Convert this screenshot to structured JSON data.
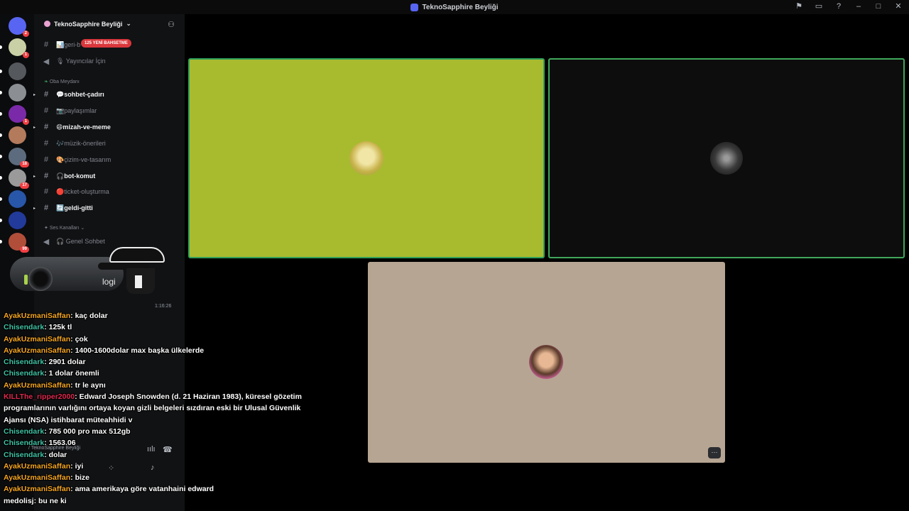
{
  "window": {
    "title": "TeknoSapphire Beyliği"
  },
  "servers": [
    {
      "badge": "2",
      "color": "#5865f2"
    },
    {
      "badge": "1",
      "color": "#c9d0a5"
    },
    {
      "badge": "",
      "color": "#55585d"
    },
    {
      "badge": "",
      "color": "#8b8e93"
    },
    {
      "badge": "1",
      "color": "#7a2aa8"
    },
    {
      "badge": "",
      "color": "#b37a5c"
    },
    {
      "badge": "18",
      "color": "#5c6c7e"
    },
    {
      "badge": "17",
      "color": "#9a9a9a"
    },
    {
      "badge": "",
      "color": "#2856a8"
    },
    {
      "badge": "",
      "color": "#223a9a"
    },
    {
      "badge": "99",
      "color": "#b04e3a"
    }
  ],
  "sidebar": {
    "guild_name": "TeknoSapphire Beyliği",
    "mention_pill": "125 YENİ BAHSETME",
    "channels_top": [
      {
        "icon": "#",
        "label": "📊geri-b",
        "active": false
      },
      {
        "icon": "🔊",
        "label": "🎙 Yayıncılar İçin",
        "active": false
      }
    ],
    "category_1": "Oba Meydanı",
    "channels_1": [
      {
        "icon": "#",
        "label": "💬sohbet-çadırı",
        "active": true
      },
      {
        "icon": "#",
        "label": "📷paylaşımlar",
        "active": false
      },
      {
        "icon": "#",
        "label": "😄mizah-ve-meme",
        "active": true
      },
      {
        "icon": "#",
        "label": "🎶müzik-önerileri",
        "active": false
      },
      {
        "icon": "#",
        "label": "🎨çizim-ve-tasarım",
        "active": false
      },
      {
        "icon": "#",
        "label": "🎧bot-komut",
        "active": true
      },
      {
        "icon": "#",
        "label": "🔴ticket-oluşturma",
        "active": false
      },
      {
        "icon": "#",
        "label": "🔄geldi-gitti",
        "active": true
      }
    ],
    "category_2": "Ses Kanalları",
    "voice_channel": "🎧 Genel Sohbet",
    "voice_connected": "/ TeknoSapphire Beyliği"
  },
  "stage": {
    "tiles": [
      {
        "bg": "#a8bb2f",
        "border": "#2fa05a"
      },
      {
        "bg": "#0d0d0d",
        "border": "#3fa85b"
      },
      {
        "bg": "#b6a592",
        "border": ""
      }
    ],
    "more_label": "···"
  },
  "webcam": {
    "brand": "logi"
  },
  "timestamp": "1:16:26",
  "chat": [
    {
      "user": "AyakUzmaniSaffan",
      "color": "#f5a623",
      "text": "kaç dolar"
    },
    {
      "user": "Chisendark",
      "color": "#3fc1a4",
      "text": "125k tl"
    },
    {
      "user": "AyakUzmaniSaffan",
      "color": "#f5a623",
      "text": "çok"
    },
    {
      "user": "AyakUzmaniSaffan",
      "color": "#f5a623",
      "text": "1400-1600dolar max başka ülkelerde"
    },
    {
      "user": "Chisendark",
      "color": "#3fc1a4",
      "text": "2901 dolar"
    },
    {
      "user": "Chisendark",
      "color": "#3fc1a4",
      "text": "1 dolar önemli"
    },
    {
      "user": "AyakUzmaniSaffan",
      "color": "#f5a623",
      "text": "tr le aynı"
    },
    {
      "user": "KILLThe_ripper2000",
      "color": "#e0284f",
      "text": "Edward Joseph Snowden (d. 21 Haziran 1983), küresel gözetim programlarının varlığını ortaya koyan gizli belgeleri sızdıran eski bir Ulusal Güvenlik Ajansı (NSA) istihbarat müteahhidi v"
    },
    {
      "user": "Chisendark",
      "color": "#3fc1a4",
      "text": "785 000 pro max 512gb"
    },
    {
      "user": "Chisendark",
      "color": "#3fc1a4",
      "text": "1563.06"
    },
    {
      "user": "Chisendark",
      "color": "#3fc1a4",
      "text": "dolar"
    },
    {
      "user": "AyakUzmaniSaffan",
      "color": "#f5a623",
      "text": "iyi"
    },
    {
      "user": "AyakUzmaniSaffan",
      "color": "#f5a623",
      "text": "bize"
    },
    {
      "user": "AyakUzmaniSaffan",
      "color": "#f5a623",
      "text": "ama amerikaya göre vatanhaini edward"
    },
    {
      "user": "medolisj",
      "color": "#ffffff",
      "text": "bu ne ki"
    }
  ]
}
